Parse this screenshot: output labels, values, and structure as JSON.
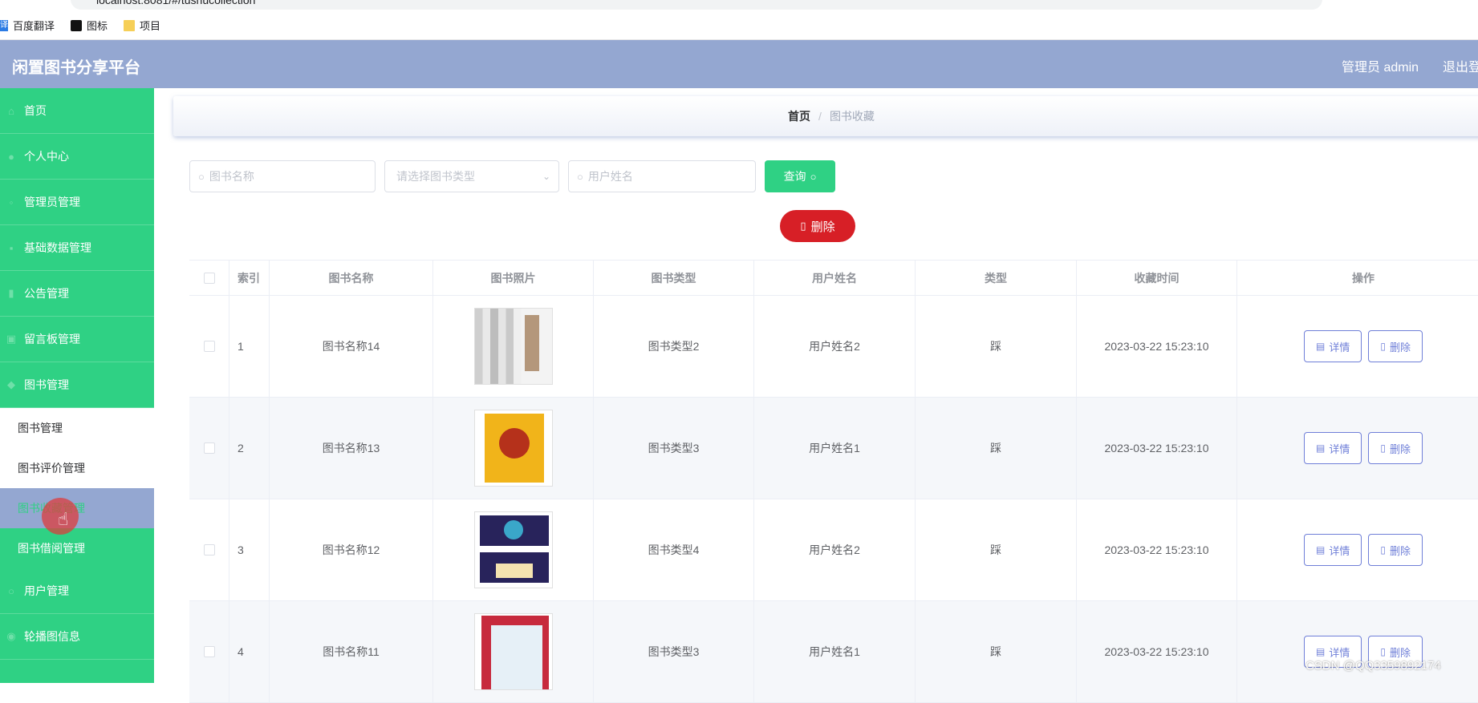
{
  "browser": {
    "url": "localhost:8081/#/tushucollection",
    "bookmarks": [
      {
        "label": "百度翻译",
        "icon": "baidu-translate-icon"
      },
      {
        "label": "图标",
        "icon": "tubiao-icon"
      },
      {
        "label": "项目",
        "icon": "folder-icon"
      }
    ]
  },
  "header": {
    "title": "闲置图书分享平台",
    "admin": "管理员 admin",
    "logout": "退出登"
  },
  "sidebar": {
    "items": [
      {
        "label": "首页",
        "icon": "home-icon"
      },
      {
        "label": "个人中心",
        "icon": "user-icon"
      },
      {
        "label": "管理员管理",
        "icon": "admin-icon"
      },
      {
        "label": "基础数据管理",
        "icon": "data-icon"
      },
      {
        "label": "公告管理",
        "icon": "chart-icon"
      },
      {
        "label": "留言板管理",
        "icon": "message-icon"
      },
      {
        "label": "图书管理",
        "icon": "book-icon"
      }
    ],
    "submenu": [
      {
        "label": "图书管理"
      },
      {
        "label": "图书评价管理"
      },
      {
        "label": "图书收藏管理"
      },
      {
        "label": "图书借阅管理"
      }
    ],
    "bottom_items": [
      {
        "label": "用户管理",
        "icon": "users-icon"
      },
      {
        "label": "轮播图信息",
        "icon": "image-icon"
      }
    ]
  },
  "breadcrumb": {
    "home": "首页",
    "separator": "/",
    "current": "图书收藏"
  },
  "search": {
    "book_name_placeholder": "图书名称",
    "book_type_placeholder": "请选择图书类型",
    "user_name_placeholder": "用户姓名",
    "query_label": "查询"
  },
  "actions": {
    "delete_label": "删除"
  },
  "table": {
    "headers": [
      "索引",
      "图书名称",
      "图书照片",
      "图书类型",
      "用户姓名",
      "类型",
      "收藏时间",
      "操作"
    ],
    "rows": [
      {
        "index": "1",
        "name": "图书名称14",
        "cover": "cover-1",
        "type": "图书类型2",
        "user": "用户姓名2",
        "kind": "踩",
        "time": "2023-03-22 15:23:10"
      },
      {
        "index": "2",
        "name": "图书名称13",
        "cover": "cover-2",
        "type": "图书类型3",
        "user": "用户姓名1",
        "kind": "踩",
        "time": "2023-03-22 15:23:10"
      },
      {
        "index": "3",
        "name": "图书名称12",
        "cover": "cover-3",
        "type": "图书类型4",
        "user": "用户姓名2",
        "kind": "踩",
        "time": "2023-03-22 15:23:10"
      },
      {
        "index": "4",
        "name": "图书名称11",
        "cover": "cover-4",
        "type": "图书类型3",
        "user": "用户姓名1",
        "kind": "踩",
        "time": "2023-03-22 15:23:10"
      }
    ],
    "detail_label": "详情",
    "delete_label": "删除"
  },
  "watermark": "CSDN @QQ3359892174",
  "colors": {
    "header": "#94a7d1",
    "sidebar": "#2fd184",
    "delete_button": "#d71f26",
    "op_button": "#6f7fd8"
  }
}
